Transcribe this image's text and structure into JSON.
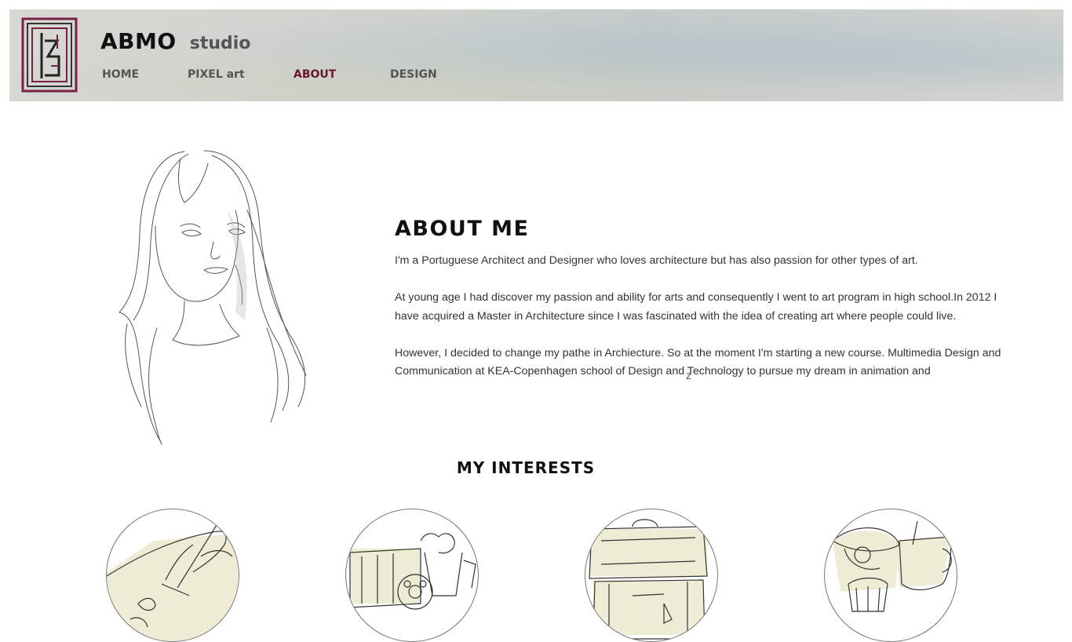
{
  "brand": {
    "name": "ABMO",
    "sub": "studio"
  },
  "nav": [
    {
      "label": "HOME",
      "active": false
    },
    {
      "label": "PIXEL art",
      "active": false
    },
    {
      "label": "ABOUT",
      "active": true
    },
    {
      "label": "DESIGN",
      "active": false
    }
  ],
  "about": {
    "title": "ABOUT ME",
    "paragraphs": [
      "I'm a Portuguese Architect and Designer who loves architecture but has also passion for other types of art.",
      "At young age I had discover my passion and ability for arts and consequently I went to art program in high school.In 2012 I have acquired a Master in Architecture since I was fascinated with the idea of creating art where people could live.",
      "However, I decided to change my pathe in Archiecture. So at the moment I'm starting a new course. Multimedia Design and Communication at KEA-Copenhagen school of Design and Technology to pursue my dream in animation and"
    ],
    "stray_char": "z"
  },
  "interests": {
    "title": "MY INTERESTS",
    "items": [
      {
        "icon": "drawing-hand-icon"
      },
      {
        "icon": "cinema-popcorn-icon"
      },
      {
        "icon": "suitcase-travel-icon"
      },
      {
        "icon": "cupcake-tea-icon"
      }
    ]
  },
  "colors": {
    "accent": "#6b1438",
    "logo": "#7a1f45",
    "text": "#333333",
    "sketch_fill": "#efecd6"
  }
}
